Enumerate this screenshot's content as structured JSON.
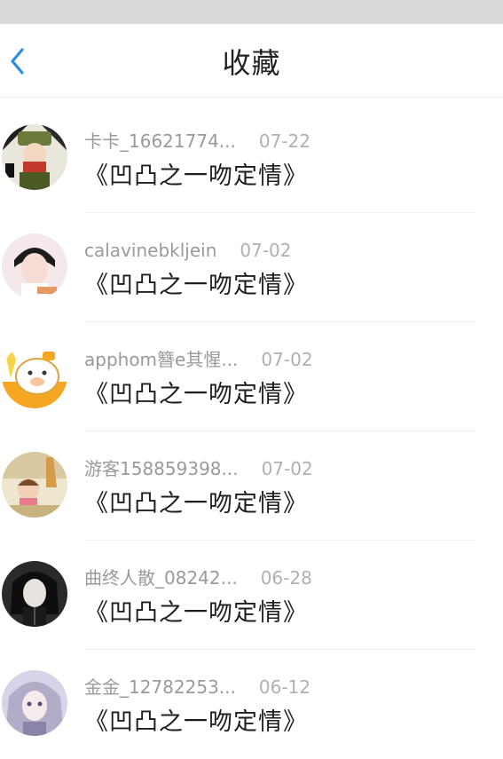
{
  "header": {
    "title": "收藏",
    "back_icon": "chevron-left-icon",
    "accent_color": "#2a8fe0"
  },
  "favorites": [
    {
      "username": "卡卡_16621774...",
      "date": "07-22",
      "title": "《凹凸之一吻定情》"
    },
    {
      "username": "calavinebkljein",
      "date": "07-02",
      "title": "《凹凸之一吻定情》"
    },
    {
      "username": "apphom簪e其惺...",
      "date": "07-02",
      "title": "《凹凸之一吻定情》"
    },
    {
      "username": "游客158859398...",
      "date": "07-02",
      "title": "《凹凸之一吻定情》"
    },
    {
      "username": "曲终人散_08242...",
      "date": "06-28",
      "title": "《凹凸之一吻定情》"
    },
    {
      "username": "金金_12782253...",
      "date": "06-12",
      "title": "《凹凸之一吻定情》"
    }
  ]
}
